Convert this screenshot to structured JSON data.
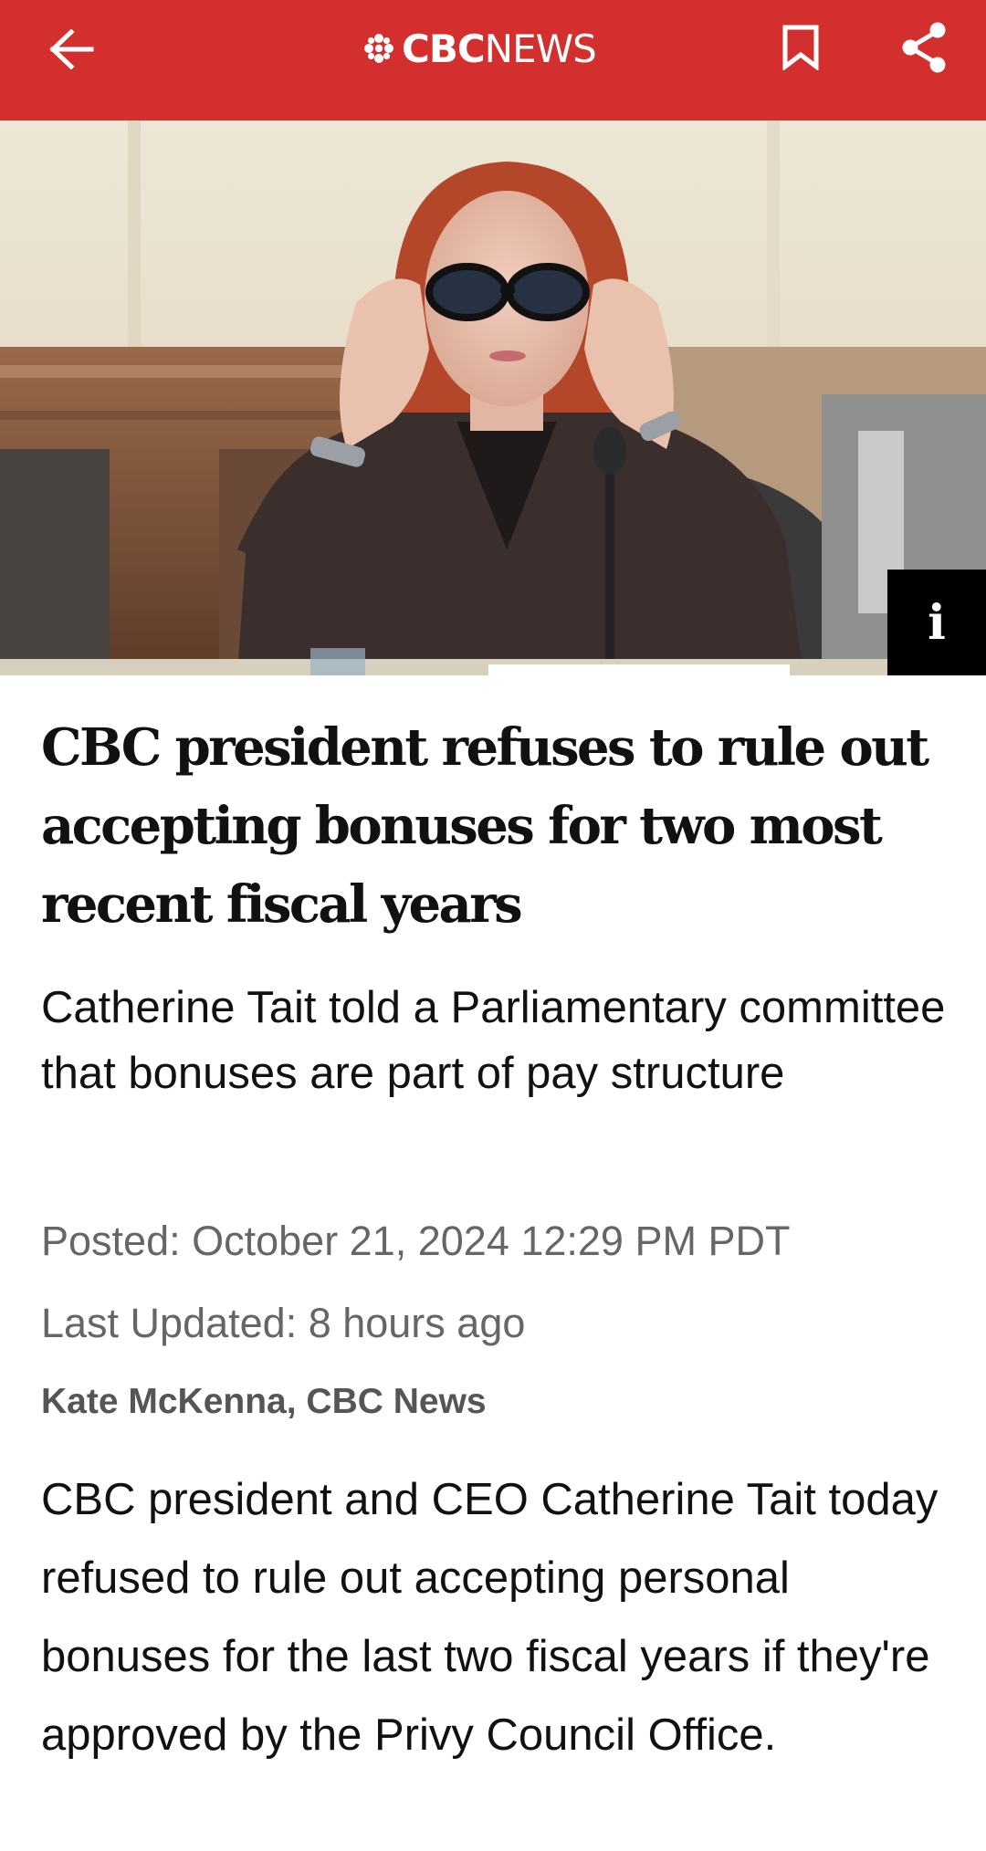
{
  "header": {
    "brand_strong": "CBC",
    "brand_light": "NEWS",
    "back_icon": "arrow-left-icon",
    "bookmark_icon": "bookmark-icon",
    "share_icon": "share-icon",
    "background_color": "#d32f2f"
  },
  "hero": {
    "info_label": "i"
  },
  "article": {
    "headline": "CBC president refuses to rule out accepting bonuses for two most recent fiscal years",
    "deck": "Catherine Tait told a Parliamentary committee that bonuses are part of pay structure",
    "posted": "Posted: October 21, 2024 12:29 PM PDT",
    "last_updated": "Last Updated: 8 hours ago",
    "byline": "Kate McKenna, CBC News",
    "body": "CBC president and CEO Catherine Tait today refused to rule out accepting personal bonuses for the last two fiscal years if they're approved by the Privy Council Office."
  }
}
